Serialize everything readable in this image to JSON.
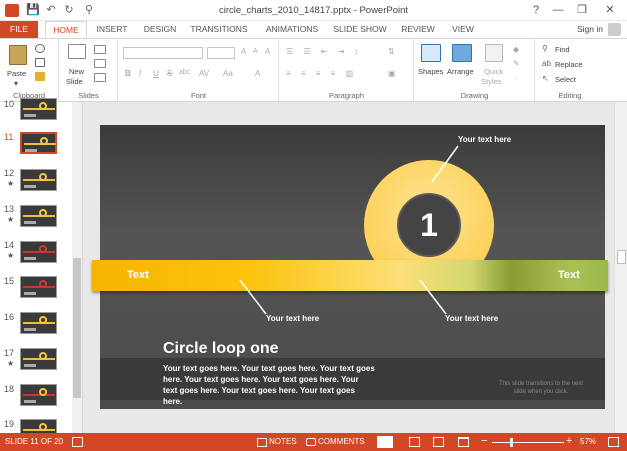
{
  "window": {
    "title": "circle_charts_2010_14817.pptx - PowerPoint",
    "controls": {
      "help": "?",
      "minimize": "—",
      "restore": "❐",
      "close": "✕"
    }
  },
  "quick_access": {
    "save": "💾",
    "undo": "↶",
    "redo": "↻",
    "customize": "⚲"
  },
  "tabs": [
    {
      "label": "FILE"
    },
    {
      "label": "HOME"
    },
    {
      "label": "INSERT"
    },
    {
      "label": "DESIGN"
    },
    {
      "label": "TRANSITIONS"
    },
    {
      "label": "ANIMATIONS"
    },
    {
      "label": "SLIDE SHOW"
    },
    {
      "label": "REVIEW"
    },
    {
      "label": "VIEW"
    }
  ],
  "signin": "Sign in",
  "ribbon": {
    "clipboard": {
      "label": "Clipboard",
      "paste": "Paste"
    },
    "slides": {
      "label": "Slides",
      "new_slide_1": "New",
      "new_slide_2": "Slide"
    },
    "font": {
      "label": "Font",
      "bold": "B",
      "italic": "I",
      "underline": "U",
      "strike": "S",
      "shadow": "abc",
      "spacing": "AV",
      "case": "Aa",
      "grow": "A",
      "shrink": "A",
      "clear": "A"
    },
    "paragraph": {
      "label": "Paragraph"
    },
    "drawing": {
      "label": "Drawing",
      "shapes": "Shapes",
      "arrange": "Arrange",
      "quick_styles_1": "Quick",
      "quick_styles_2": "Styles"
    },
    "editing": {
      "label": "Editing",
      "find": "Find",
      "replace": "Replace",
      "select": "Select"
    }
  },
  "thumbnails": [
    {
      "num": "10",
      "star": ""
    },
    {
      "num": "11",
      "star": ""
    },
    {
      "num": "12",
      "star": "★"
    },
    {
      "num": "13",
      "star": "★"
    },
    {
      "num": "14",
      "star": "★"
    },
    {
      "num": "15",
      "star": ""
    },
    {
      "num": "16",
      "star": ""
    },
    {
      "num": "17",
      "star": "★"
    },
    {
      "num": "18",
      "star": ""
    },
    {
      "num": "19",
      "star": ""
    }
  ],
  "slide": {
    "number": "1",
    "left_text": "Text",
    "right_text": "Text",
    "callout_top": "Your text here",
    "callout_left": "Your text here",
    "callout_right": "Your text here",
    "heading": "Circle loop one",
    "body": "Your text goes here. Your text goes here. Your text goes here. Your text goes here. Your text goes here. Your text goes here. Your text goes here. Your text goes here.",
    "note": "This slide transitions to the next slide when you click.",
    "colors": {
      "yellow": "#fcc20c",
      "green": "#9cb84b",
      "dark": "#3b3b3b"
    }
  },
  "status": {
    "slide_info": "SLIDE 11 OF 20",
    "notes": "NOTES",
    "comments": "COMMENTS",
    "zoom": "57%",
    "zoom_percent": 57,
    "minus": "−",
    "plus": "+"
  }
}
